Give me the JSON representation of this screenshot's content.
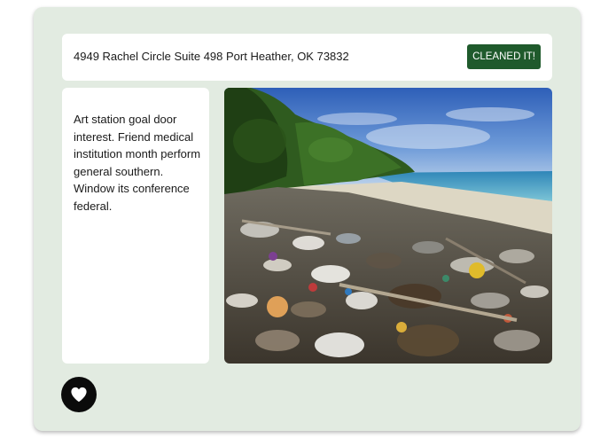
{
  "location": {
    "address": "4949 Rachel Circle Suite 498 Port Heather, OK 73832",
    "cleaned_label": "CLEANED IT!"
  },
  "description": {
    "text": "Art station goal door interest. Friend medical institution month perform general southern. Window its conference federal."
  },
  "photo": {
    "subject": "beach-covered-in-plastic-debris"
  },
  "favorite": {
    "icon": "heart-icon"
  },
  "colors": {
    "card_background": "#e2ebe1",
    "button_green": "#1f5a2c",
    "heart_button": "#0b0b0b"
  }
}
